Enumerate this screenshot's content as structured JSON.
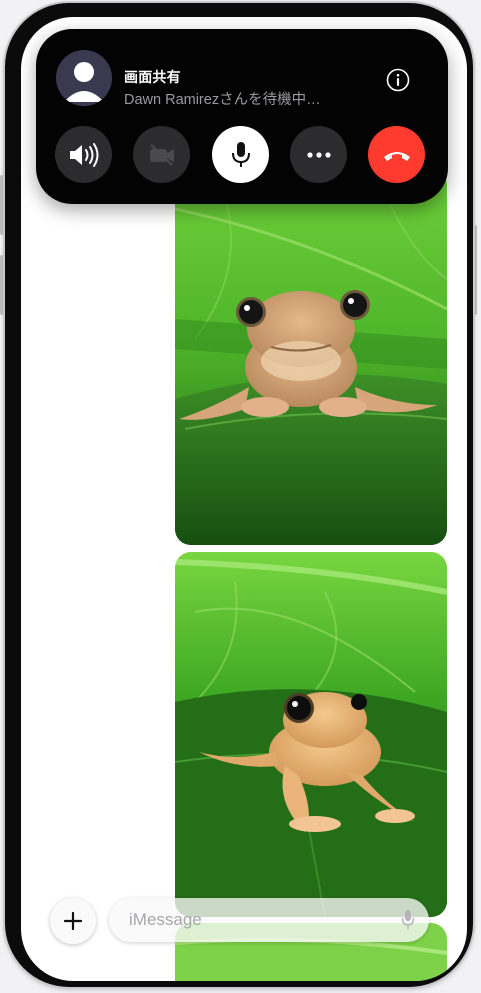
{
  "call": {
    "title": "画面共有",
    "subtitle": "Dawn Ramirezさんを待機中…",
    "controls": [
      {
        "name": "speaker-button",
        "icon": "speaker-icon"
      },
      {
        "name": "camera-off-button",
        "icon": "video-off-icon"
      },
      {
        "name": "mute-button",
        "icon": "microphone-icon"
      },
      {
        "name": "more-button",
        "icon": "ellipsis-icon"
      },
      {
        "name": "end-call-button",
        "icon": "phone-hangup-icon"
      }
    ]
  },
  "thread": {
    "messages": [
      {
        "type": "photo",
        "subject": "frog on leaf (front view)"
      },
      {
        "type": "photo",
        "subject": "frog on leaf (three-quarter view)"
      },
      {
        "type": "photo",
        "subject": "frog on leaf (partially visible)"
      }
    ]
  },
  "compose": {
    "placeholder": "iMessage"
  },
  "colors": {
    "end_call": "#ff3b30",
    "banner_bg": "#030303",
    "control_bg": "#2c2c2e",
    "leaf_green": "#2f8f1f"
  }
}
